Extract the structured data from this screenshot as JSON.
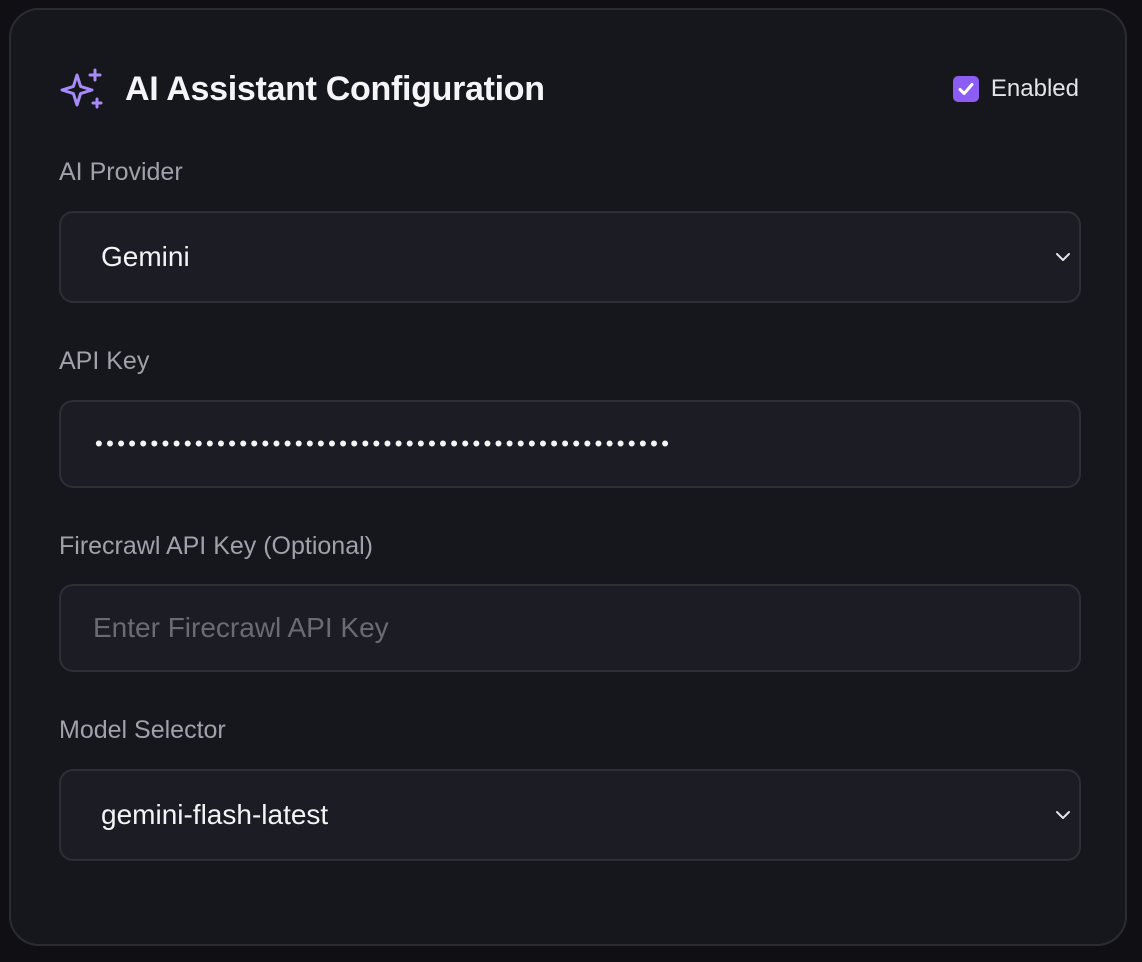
{
  "header": {
    "title": "AI Assistant Configuration",
    "icon": "sparkles-icon",
    "enabled_label": "Enabled",
    "enabled": true
  },
  "fields": {
    "provider": {
      "label": "AI Provider",
      "value": "Gemini"
    },
    "api_key": {
      "label": "API Key",
      "masked_value": "••••••••••••••••••••••••••••••••••••••••••••••••••••"
    },
    "firecrawl_key": {
      "label": "Firecrawl API Key (Optional)",
      "value": "",
      "placeholder": "Enter Firecrawl API Key"
    },
    "model": {
      "label": "Model Selector",
      "value": "gemini-flash-latest"
    }
  },
  "colors": {
    "accent": "#8b5cf6",
    "card_background": "#16161d",
    "field_background": "#1c1c24"
  }
}
